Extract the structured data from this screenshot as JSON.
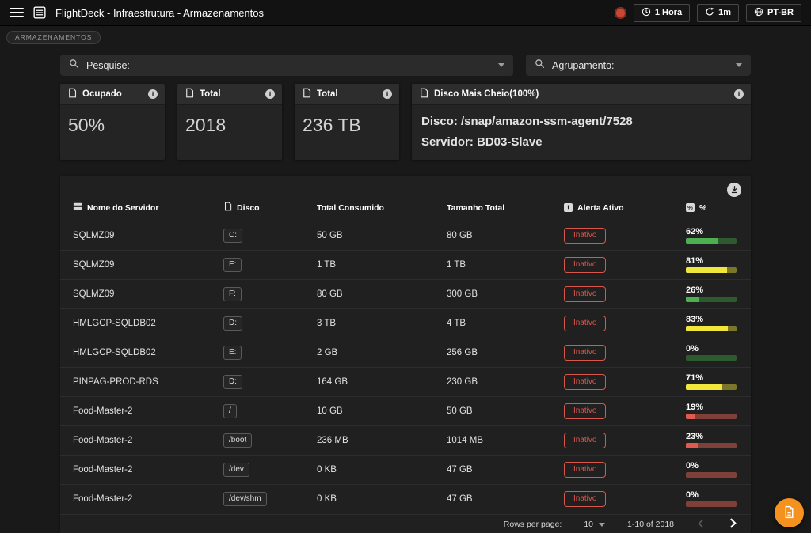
{
  "topbar": {
    "title": "FlightDeck - Infraestrutura - Armazenamentos",
    "time_range_label": "1 Hora",
    "refresh_label": "1m",
    "locale_label": "PT-BR"
  },
  "breadcrumb": {
    "label": "ARMAZENAMENTOS"
  },
  "filters": {
    "search_label": "Pesquise:",
    "group_label": "Agrupamento:"
  },
  "stat_cards": [
    {
      "title": "Ocupado",
      "value": "50%"
    },
    {
      "title": "Total",
      "value": "2018"
    },
    {
      "title": "Total",
      "value": "236 TB"
    },
    {
      "title": "Disco Mais Cheio(100%)",
      "lines": [
        "Disco: /snap/amazon-ssm-agent/7528",
        "Servidor: BD03-Slave"
      ]
    }
  ],
  "table": {
    "columns": [
      {
        "label": "Nome do Servidor",
        "icon": "server-icon"
      },
      {
        "label": "Disco",
        "icon": "disk-icon"
      },
      {
        "label": "Total Consumido"
      },
      {
        "label": "Tamanho Total"
      },
      {
        "label": "Alerta Ativo",
        "icon": "alert-icon"
      },
      {
        "label": "%",
        "icon": "percent-icon"
      }
    ],
    "rows": [
      {
        "server": "SQLMZ09",
        "disk": "C:",
        "used": "50 GB",
        "total": "80 GB",
        "alert": "Inativo",
        "pct": "62%",
        "pct_value": 62,
        "bar_color": "green"
      },
      {
        "server": "SQLMZ09",
        "disk": "E:",
        "used": "1 TB",
        "total": "1 TB",
        "alert": "Inativo",
        "pct": "81%",
        "pct_value": 81,
        "bar_color": "yellow"
      },
      {
        "server": "SQLMZ09",
        "disk": "F:",
        "used": "80 GB",
        "total": "300 GB",
        "alert": "Inativo",
        "pct": "26%",
        "pct_value": 26,
        "bar_color": "green"
      },
      {
        "server": "HMLGCP-SQLDB02",
        "disk": "D:",
        "used": "3 TB",
        "total": "4 TB",
        "alert": "Inativo",
        "pct": "83%",
        "pct_value": 83,
        "bar_color": "yellow"
      },
      {
        "server": "HMLGCP-SQLDB02",
        "disk": "E:",
        "used": "2 GB",
        "total": "256 GB",
        "alert": "Inativo",
        "pct": "0%",
        "pct_value": 0,
        "bar_color": "green"
      },
      {
        "server": "PINPAG-PROD-RDS",
        "disk": "D:",
        "used": "164 GB",
        "total": "230 GB",
        "alert": "Inativo",
        "pct": "71%",
        "pct_value": 71,
        "bar_color": "yellow"
      },
      {
        "server": "Food-Master-2",
        "disk": "/",
        "used": "10 GB",
        "total": "50 GB",
        "alert": "Inativo",
        "pct": "19%",
        "pct_value": 19,
        "bar_color": "red"
      },
      {
        "server": "Food-Master-2",
        "disk": "/boot",
        "used": "236 MB",
        "total": "1014 MB",
        "alert": "Inativo",
        "pct": "23%",
        "pct_value": 23,
        "bar_color": "red"
      },
      {
        "server": "Food-Master-2",
        "disk": "/dev",
        "used": "0 KB",
        "total": "47 GB",
        "alert": "Inativo",
        "pct": "0%",
        "pct_value": 0,
        "bar_color": "red"
      },
      {
        "server": "Food-Master-2",
        "disk": "/dev/shm",
        "used": "0 KB",
        "total": "47 GB",
        "alert": "Inativo",
        "pct": "0%",
        "pct_value": 0,
        "bar_color": "red"
      }
    ],
    "footer": {
      "rows_per_page_label": "Rows per page:",
      "rows_per_page_value": "10",
      "range_label": "1-10 of 2018"
    }
  },
  "colors": {
    "accent_orange": "#f5911e",
    "alert_red": "#e0584d",
    "bar_green": "#4caf50",
    "bar_yellow": "#f0e63c",
    "bar_red": "#e05a4d",
    "status_dot": "#c94534"
  }
}
